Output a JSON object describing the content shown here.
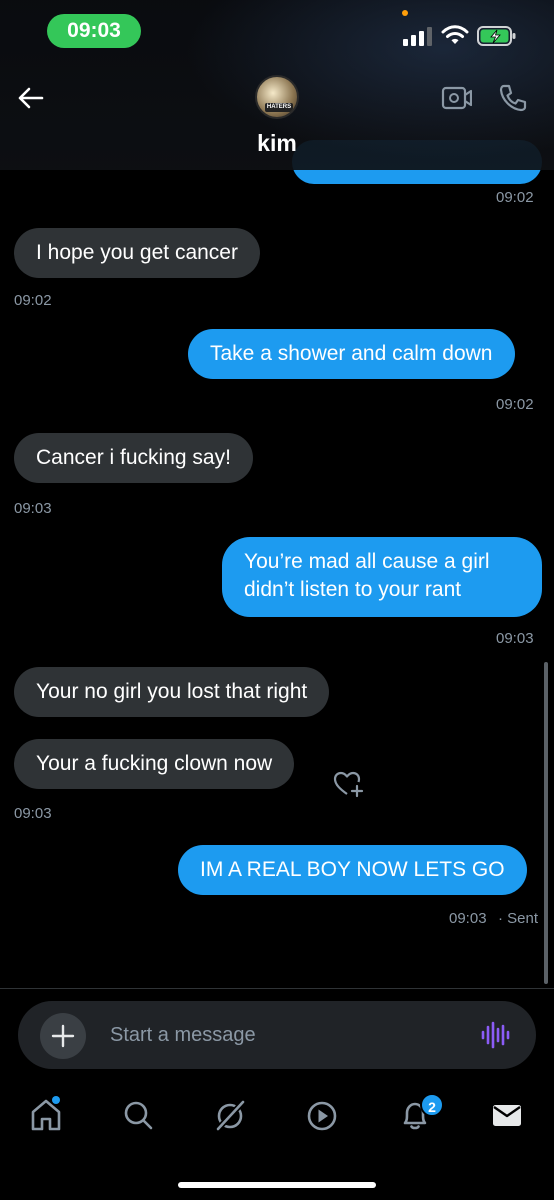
{
  "status_bar": {
    "time": "09:03"
  },
  "header": {
    "contact_name": "kim",
    "avatar_badge": "HATERS"
  },
  "messages": [
    {
      "dir": "out-partial",
      "time": "09:02"
    },
    {
      "dir": "in",
      "text": "I hope you get cancer",
      "time": "09:02"
    },
    {
      "dir": "out",
      "text": "Take a shower and calm down",
      "time": "09:02"
    },
    {
      "dir": "in",
      "text": "Cancer i fucking say!",
      "time": "09:03"
    },
    {
      "dir": "out",
      "text": "You’re mad all cause a girl didn’t listen to your rant",
      "line1": "You’re mad all cause a girl",
      "line2": "didn’t listen to your rant",
      "time": "09:03"
    },
    {
      "dir": "in",
      "text": "Your no girl you lost that right"
    },
    {
      "dir": "in",
      "text": "Your a fucking clown now",
      "time": "09:03"
    },
    {
      "dir": "out",
      "text": "IM A REAL BOY NOW LETS GO",
      "time": "09:03",
      "status": "· Sent"
    }
  ],
  "composer": {
    "placeholder": "Start a message"
  },
  "tabbar": {
    "items": [
      "home",
      "search",
      "grok",
      "video",
      "notifications",
      "messages"
    ],
    "notifications_count": "2"
  },
  "colors": {
    "accent": "#1d9bf0",
    "incoming_bubble": "#2f3336",
    "status_green": "#34c759",
    "voice_purple": "#8b5cf6"
  }
}
